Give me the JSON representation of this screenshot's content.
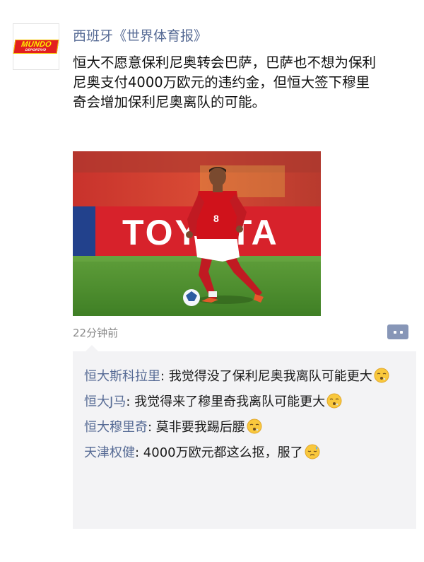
{
  "post": {
    "author": "西班牙《世界体育报》",
    "avatar_logo": {
      "main": "MUNDO",
      "sub": "DEPORTIVO"
    },
    "text": "恒大不愿意保利尼奥转会巴萨，巴萨也不想为保利尼奥支付4000万欧元的违约金，但恒大签下穆里奇会增加保利尼奥离队的可能。",
    "photo": {
      "board_text": "TOYOTA",
      "shirt_number": "8"
    },
    "timestamp": "22分钟前",
    "comment_button_icon": "comment-dots-icon"
  },
  "comments": [
    {
      "name": "恒大斯科拉里",
      "separator": ": ",
      "text": "我觉得没了保利尼奥我离队可能更大",
      "emoji": "face-exhaling-emoji"
    },
    {
      "name": "恒大J马",
      "separator": ": ",
      "text": "我觉得来了穆里奇我离队可能更大",
      "emoji": "face-exhaling-emoji"
    },
    {
      "name": "恒大穆里奇",
      "separator": ": ",
      "text": "莫非要我踢后腰",
      "emoji": "face-exhaling-emoji"
    },
    {
      "name": "天津权健",
      "separator": ": ",
      "text": "4000万欧元都这么抠，服了",
      "emoji": "sweat-face-emoji"
    }
  ],
  "colors": {
    "link_blue": "#576b95",
    "comment_bg": "#f3f3f5",
    "timestamp_grey": "#8a8a8a",
    "jersey_red": "#d0121b",
    "logo_red": "#e21f1f",
    "logo_yellow": "#fff200"
  }
}
